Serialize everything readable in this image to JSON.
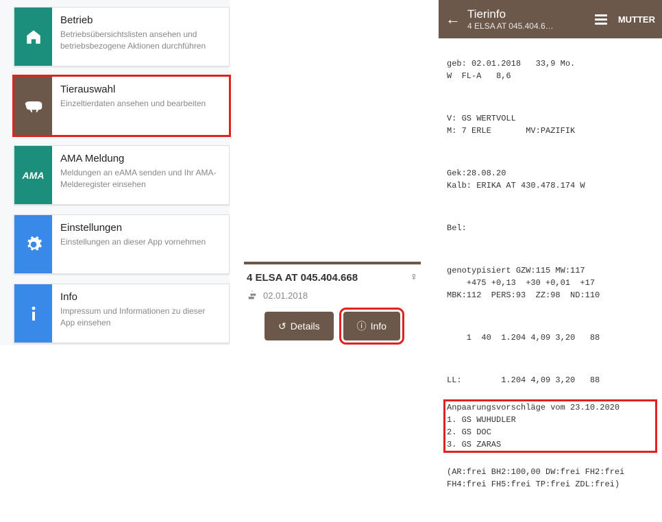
{
  "menu": [
    {
      "title": "Betrieb",
      "sub": "Betriebsübersichtslisten ansehen und betriebsbezogene Aktionen durchführen"
    },
    {
      "title": "Tierauswahl",
      "sub": "Einzeltierdaten ansehen und bearbeiten"
    },
    {
      "title": "AMA Meldung",
      "sub": "Meldungen an eAMA senden und Ihr AMA-Melderegister einsehen"
    },
    {
      "title": "Einstellungen",
      "sub": "Einstellungen an dieser App vornehmen"
    },
    {
      "title": "Info",
      "sub": "Impressum und Informationen zu dieser App einsehen"
    }
  ],
  "animal": {
    "name": "4 ELSA AT 045.404.668",
    "birth": "02.01.2018",
    "sex": "♀"
  },
  "buttons": {
    "details": "Details",
    "info": "Info"
  },
  "p3": {
    "title": "Tierinfo",
    "subtitle": "4 ELSA AT 045.404.6…",
    "mutter": "MUTTER",
    "block1": "geb: 02.01.2018   33,9 Mo.\nW  FL-A   8,6",
    "block2": "V: GS WERTVOLL\nM: 7 ERLE       MV:PAZIFIK",
    "block3": "Gek:28.08.20\nKalb: ERIKA AT 430.478.174 W",
    "block4": "Bel:",
    "block5": "genotypisiert GZW:115 MW:117\n    +475 +0,13  +30 +0,01  +17\nMBK:112  PERS:93  ZZ:98  ND:110",
    "block6": "    1  40  1.204 4,09 3,20   88",
    "block7": "LL:        1.204 4,09 3,20   88",
    "box": "Anpaarungsvorschläge vom 23.10.2020\n1. GS WUHUDLER\n2. GS DOC\n3. GS ZARAS",
    "block8": "(AR:frei BH2:100,00 DW:frei FH2:frei\nFH4:frei FH5:frei TP:frei ZDL:frei)"
  }
}
